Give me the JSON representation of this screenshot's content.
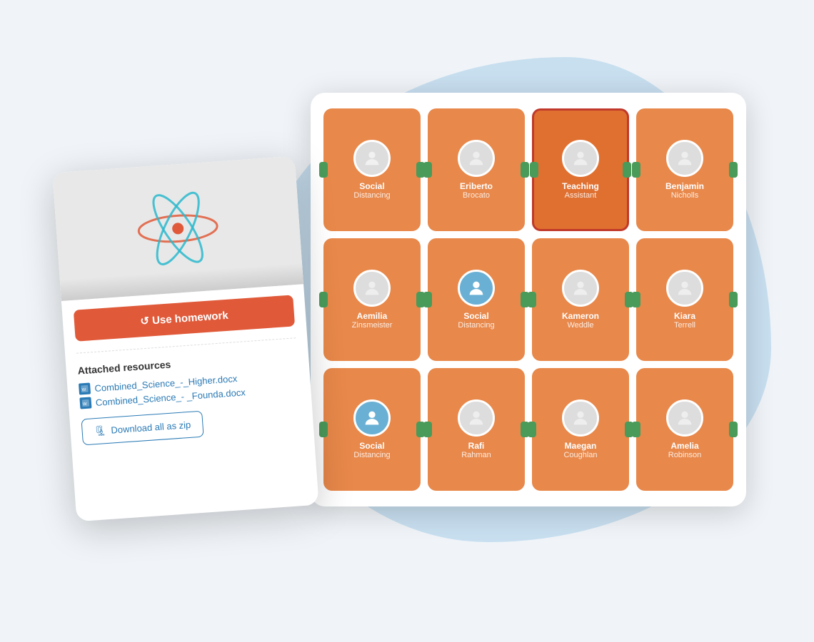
{
  "background": {
    "blob_color": "#c8dff0"
  },
  "tablet": {
    "grid": [
      [
        {
          "id": "social1",
          "name": "Social",
          "surname": "Distancing",
          "avatar_type": "photo",
          "photo_class": "avatar-photo-social1"
        },
        {
          "id": "eriberto",
          "name": "Eriberto",
          "surname": "Brocato",
          "avatar_type": "photo",
          "photo_class": "avatar-photo-eriberto"
        },
        {
          "id": "ta",
          "name": "Teaching",
          "surname": "Assistant",
          "avatar_type": "photo",
          "photo_class": "avatar-photo-ta",
          "highlighted": true
        },
        {
          "id": "benjamin",
          "name": "Benjamin",
          "surname": "Nicholls",
          "avatar_type": "photo",
          "photo_class": "avatar-photo-benjamin"
        }
      ],
      [
        {
          "id": "aemilia",
          "name": "Aemilia",
          "surname": "Zinsmeister",
          "avatar_type": "photo",
          "photo_class": "avatar-photo-aemilia"
        },
        {
          "id": "social2",
          "name": "Social",
          "surname": "Distancing",
          "avatar_type": "default",
          "photo_class": ""
        },
        {
          "id": "kameron",
          "name": "Kameron",
          "surname": "Weddle",
          "avatar_type": "photo",
          "photo_class": "avatar-photo-kameron"
        },
        {
          "id": "kiara",
          "name": "Kiara",
          "surname": "Terrell",
          "avatar_type": "photo",
          "photo_class": "avatar-photo-kiara"
        }
      ],
      [
        {
          "id": "social3",
          "name": "Social",
          "surname": "Distancing",
          "avatar_type": "default",
          "photo_class": ""
        },
        {
          "id": "rafi",
          "name": "Rafi",
          "surname": "Rahman",
          "avatar_type": "photo",
          "photo_class": "avatar-photo-rafi"
        },
        {
          "id": "maegan",
          "name": "Maegan",
          "surname": "Coughlan",
          "avatar_type": "photo",
          "photo_class": "avatar-photo-maegan"
        },
        {
          "id": "amelia",
          "name": "Amelia",
          "surname": "Robinson",
          "avatar_type": "photo",
          "photo_class": "avatar-photo-amelia"
        }
      ]
    ]
  },
  "homework_card": {
    "use_homework_label": "↺ Use homework",
    "resources_title": "Attached resources",
    "resource_link1": "Combined_Science_-_Higher.docx",
    "resource_link2": "Combined_Science_-\n_Founda.docx",
    "download_btn": "Download all as zip"
  }
}
